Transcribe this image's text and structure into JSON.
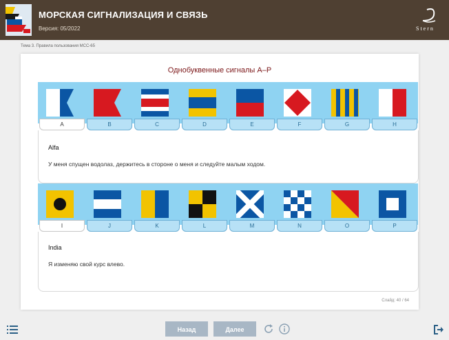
{
  "header": {
    "title": "МОРСКАЯ СИГНАЛИЗАЦИЯ И СВЯЗЬ",
    "version": "Версия: 05/2022",
    "logo_icon": "signal-flags-logo-icon",
    "brand_icon": "stern-logo-icon"
  },
  "breadcrumb": "Тема 3. Правила пользования МСС-65",
  "slide": {
    "title": "Однобуквенные сигналы A–P",
    "counter": "Слайд: 40 / 64"
  },
  "rows": [
    {
      "tabs": [
        "A",
        "B",
        "C",
        "D",
        "E",
        "F",
        "G",
        "H"
      ],
      "active_tab": "A",
      "selected_name": "Alfa",
      "selected_meaning": "У меня спущен водолаз, держитесь в стороне о меня и следуйте малым ходом."
    },
    {
      "tabs": [
        "I",
        "J",
        "K",
        "L",
        "M",
        "N",
        "O",
        "P"
      ],
      "active_tab": "I",
      "selected_name": "India",
      "selected_meaning": "Я изменяю свой курс влево."
    }
  ],
  "nav": {
    "back_label": "Назад",
    "next_label": "Далее",
    "icons": [
      "menu-icon",
      "refresh-icon",
      "info-icon",
      "exit-icon"
    ]
  },
  "colors": {
    "header_bg": "#4f4032",
    "title_red": "#7a1416",
    "strip_blue": "#8fd3f2",
    "button_gray": "#a8b7c5"
  }
}
